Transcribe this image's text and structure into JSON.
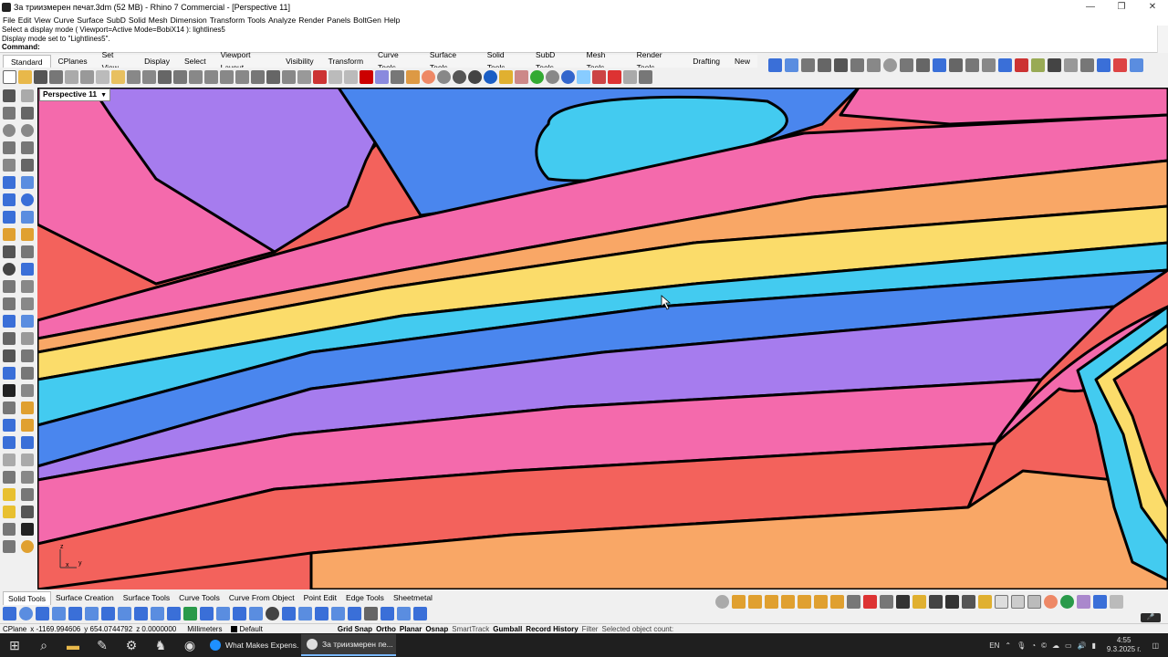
{
  "window": {
    "title": "За триизмерен печат.3dm (52 MB) - Rhino 7 Commercial - [Perspective 11]",
    "minimize": "—",
    "maximize": "❐",
    "close": "✕"
  },
  "menubar": [
    "File",
    "Edit",
    "View",
    "Curve",
    "Surface",
    "SubD",
    "Solid",
    "Mesh",
    "Dimension",
    "Transform",
    "Tools",
    "Analyze",
    "Render",
    "Panels",
    "BoltGen",
    "Help"
  ],
  "command_history": [
    "Select a display mode ( Viewport=Active  Mode=BobiX14 ): lightlines5",
    "Display mode set to \"Lightlines5\"."
  ],
  "command_prompt": "Command:",
  "toolbar_tabs": [
    "Standard",
    "CPlanes",
    "Set View",
    "Display",
    "Select",
    "Viewport Layout",
    "Visibility",
    "Transform",
    "Curve Tools",
    "Surface Tools",
    "Solid Tools",
    "SubD Tools",
    "Mesh Tools",
    "Render Tools",
    "Drafting",
    "New"
  ],
  "viewport": {
    "name": "Perspective 11",
    "axis_z": "z",
    "axis_x": "x",
    "axis_y": "y"
  },
  "bottom_tabs": [
    "Solid Tools",
    "Surface Creation",
    "Surface Tools",
    "Curve Tools",
    "Curve From Object",
    "Point Edit",
    "Edge Tools",
    "Sheetmetal"
  ],
  "status": {
    "cplane": "CPlane",
    "x": "x -1169.994606",
    "y": "y 654.0744792",
    "z": "z 0.0000000",
    "units": "Millimeters",
    "layer": "Default",
    "grid_snap": "Grid Snap",
    "ortho": "Ortho",
    "planar": "Planar",
    "osnap": "Osnap",
    "smarttrack": "SmartTrack",
    "gumball": "Gumball",
    "record_history": "Record History",
    "filter": "Filter",
    "selected": "Selected object count:"
  },
  "taskbar": {
    "apps": [
      "What Makes Expens...",
      "За триизмерен пе..."
    ],
    "lang": "EN",
    "time": "4:55",
    "date": "9.3.2025 г."
  },
  "colors": {
    "pink": "#f46aac",
    "purple": "#a67cee",
    "blue": "#4a86ee",
    "cyan": "#43cbf0",
    "yellow": "#fbdc6a",
    "orange": "#f9a766",
    "red": "#f3625c"
  }
}
